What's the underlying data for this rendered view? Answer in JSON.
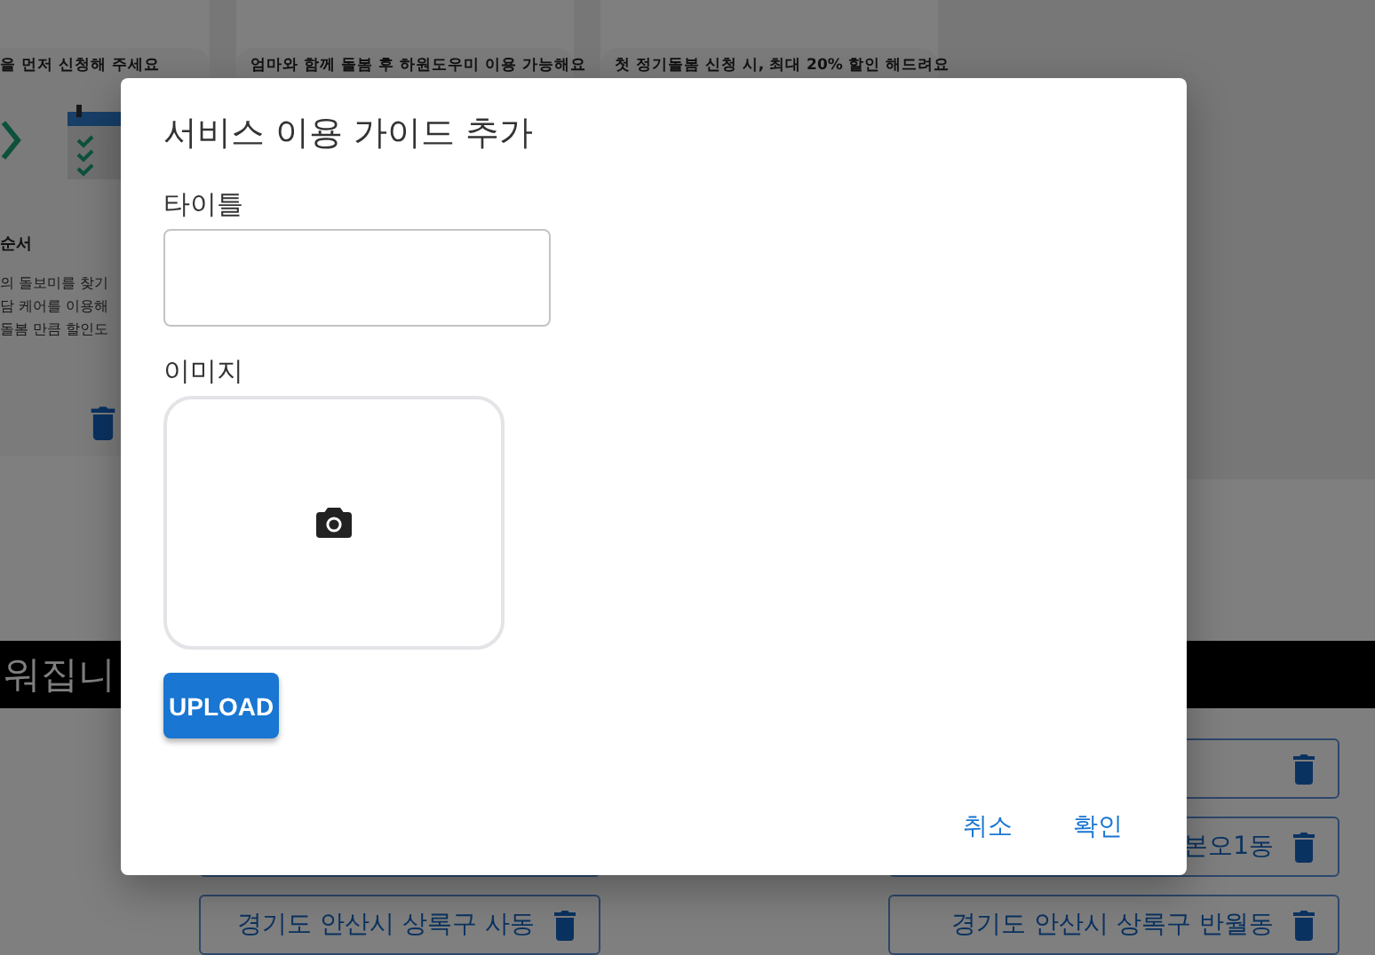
{
  "background": {
    "cards": [
      {
        "kind": "full",
        "title": "을 먼저 신청해 주세요",
        "heading": "순서",
        "lines": [
          "의 돌보미를 찾기",
          "담 케어를 이용해",
          "돌봄 만큼 할인도"
        ]
      },
      {
        "kind": "title",
        "title": "엄마와 함께 돌봄 후 하원도우미 이용 가능해요"
      },
      {
        "kind": "title",
        "title": "첫 정기돌봄 신청 시, 최대 20% 할인 해드려요"
      }
    ],
    "banner": "워집니",
    "chips": [
      {
        "kind": "right"
      },
      {
        "kind": "left"
      },
      {
        "kind": "right",
        "label": "본오1동"
      },
      {
        "kind": "left",
        "label": "경기도 안산시 상록구 사동"
      },
      {
        "kind": "right",
        "label": "경기도 안산시 상록구 반월동"
      }
    ]
  },
  "dialog": {
    "title": "서비스 이용 가이드 추가",
    "fields": [
      {
        "kind": "text",
        "label": "타이틀"
      },
      {
        "kind": "image",
        "label": "이미지",
        "button": "UPLOAD"
      }
    ],
    "actions": [
      "취소",
      "확인"
    ]
  }
}
